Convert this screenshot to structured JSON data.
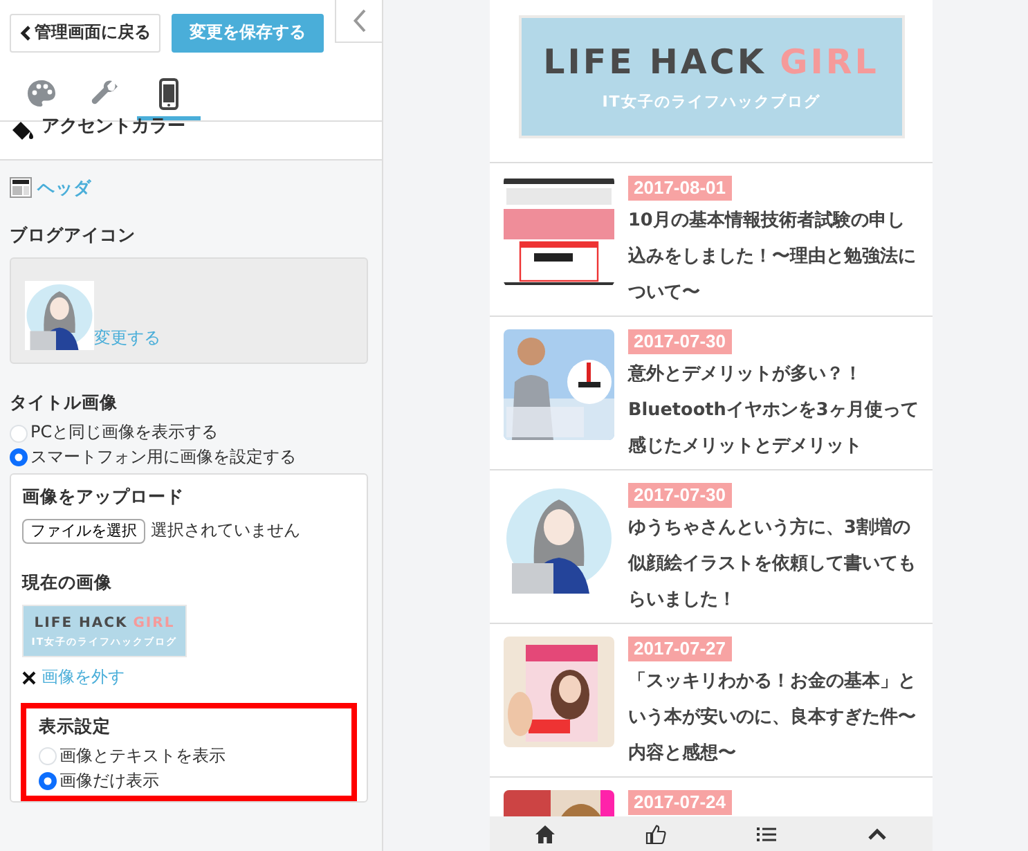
{
  "toolbar": {
    "back_button": "管理画面に戻る",
    "save_button": "変更を保存する"
  },
  "tabs": [
    {
      "kind": "palette",
      "selected": false
    },
    {
      "kind": "wrench",
      "selected": false
    },
    {
      "kind": "phone",
      "selected": true
    }
  ],
  "accent_color": "アクセントカラー",
  "header_link": "ヘッダ",
  "blog_icon": {
    "label": "ブログアイコン",
    "change_link": "変更する"
  },
  "title_image": {
    "label": "タイトル画像",
    "options": [
      {
        "label": "PCと同じ画像を表示する",
        "selected": false
      },
      {
        "label": "スマートフォン用に画像を設定する",
        "selected": true
      }
    ],
    "upload_label": "画像をアップロード",
    "file_button": "ファイルを選択",
    "file_status": "選択されていません",
    "current_label": "現在の画像",
    "current_logo": {
      "title": "LIFE HACK",
      "accent": "GIRL",
      "subtitle": "IT女子のライフハックブログ"
    },
    "remove_link": "画像を外す"
  },
  "display_setting": {
    "label": "表示設定",
    "highlighted": true,
    "options": [
      {
        "label": "画像とテキストを表示",
        "selected": false
      },
      {
        "label": "画像だけ表示",
        "selected": true
      }
    ]
  },
  "preview": {
    "logo": {
      "title": "LIFE HACK",
      "accent": "GIRL",
      "subtitle": "IT女子のライフハックブログ"
    },
    "posts": [
      {
        "date": "2017-08-01",
        "title": "10月の基本情報技術者試験の申し込みをしました！〜理由と勉強法について〜"
      },
      {
        "date": "2017-07-30",
        "title": "意外とデメリットが多い？！Bluetoothイヤホンを3ヶ月使って感じたメリットとデメリット"
      },
      {
        "date": "2017-07-30",
        "title": "ゆうちゃさんという方に、3割増の似顔絵イラストを依頼して書いてもらいました！"
      },
      {
        "date": "2017-07-27",
        "title": "「スッキリわかる！お金の基本」という本が安いのに、良本すぎた件〜内容と感想〜"
      },
      {
        "date": "2017-07-24"
      }
    ],
    "bottom_nav": [
      {
        "kind": "home"
      },
      {
        "kind": "like"
      },
      {
        "kind": "list"
      },
      {
        "kind": "top"
      }
    ]
  }
}
